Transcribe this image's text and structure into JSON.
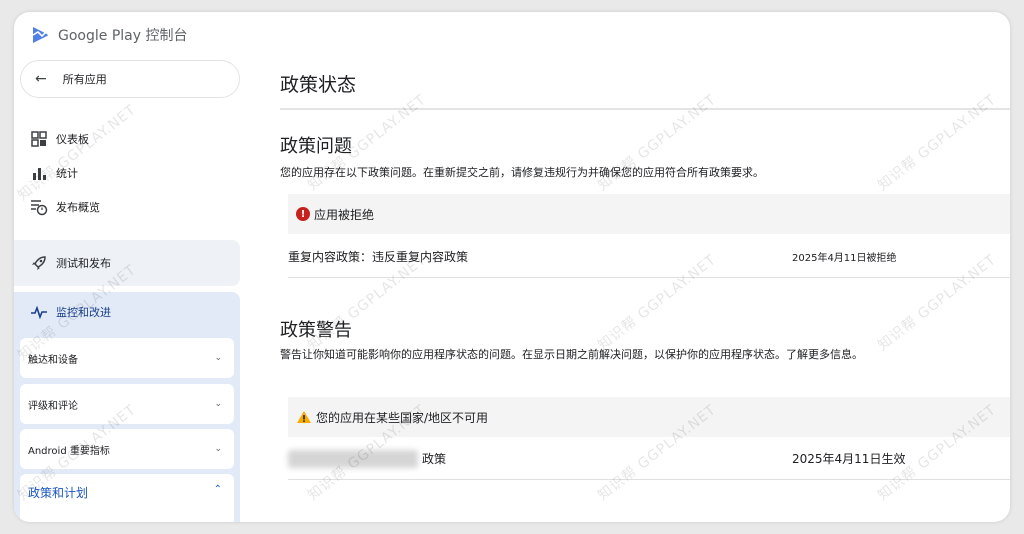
{
  "app": {
    "title": "Google Play 控制台"
  },
  "sidebar": {
    "back_label": "所有应用",
    "items": [
      {
        "label": "仪表板",
        "icon": "dashboard-icon"
      },
      {
        "label": "统计",
        "icon": "bar-chart-icon"
      },
      {
        "label": "发布概览",
        "icon": "publish-overview-icon"
      }
    ],
    "test_release": {
      "label": "测试和发布",
      "icon": "rocket-icon"
    },
    "monitor": {
      "label": "监控和改进",
      "icon": "pulse-icon",
      "subs": [
        {
          "label": "触达和设备"
        },
        {
          "label": "评级和评论"
        },
        {
          "label": "Android 重要指标"
        }
      ],
      "policy": {
        "label": "政策和计划"
      }
    }
  },
  "main": {
    "title": "政策状态",
    "issues": {
      "heading": "政策问题",
      "desc": "您的应用存在以下政策问题。在重新提交之前，请修复违规行为并确保您的应用符合所有政策要求。",
      "status": "应用被拒绝",
      "row": {
        "policy": "重复内容政策：违反重复内容政策",
        "date": "2025年4月11日被拒绝"
      }
    },
    "warnings": {
      "heading": "政策警告",
      "desc": "警告让你知道可能影响你的应用程序状态的问题。在显示日期之前解决问题，以保护你的应用程序状态。了解更多信息。",
      "status": "您的应用在某些国家/地区不可用",
      "row": {
        "policy": "政策",
        "date": "2025年4月11日生效"
      }
    }
  },
  "watermark": "知识帮 GGPLAY.NET",
  "colors": {
    "accent": "#1a56c4",
    "error": "#c5221f",
    "warning": "#f9ab00",
    "nav_highlight": "#e2eaf8"
  }
}
